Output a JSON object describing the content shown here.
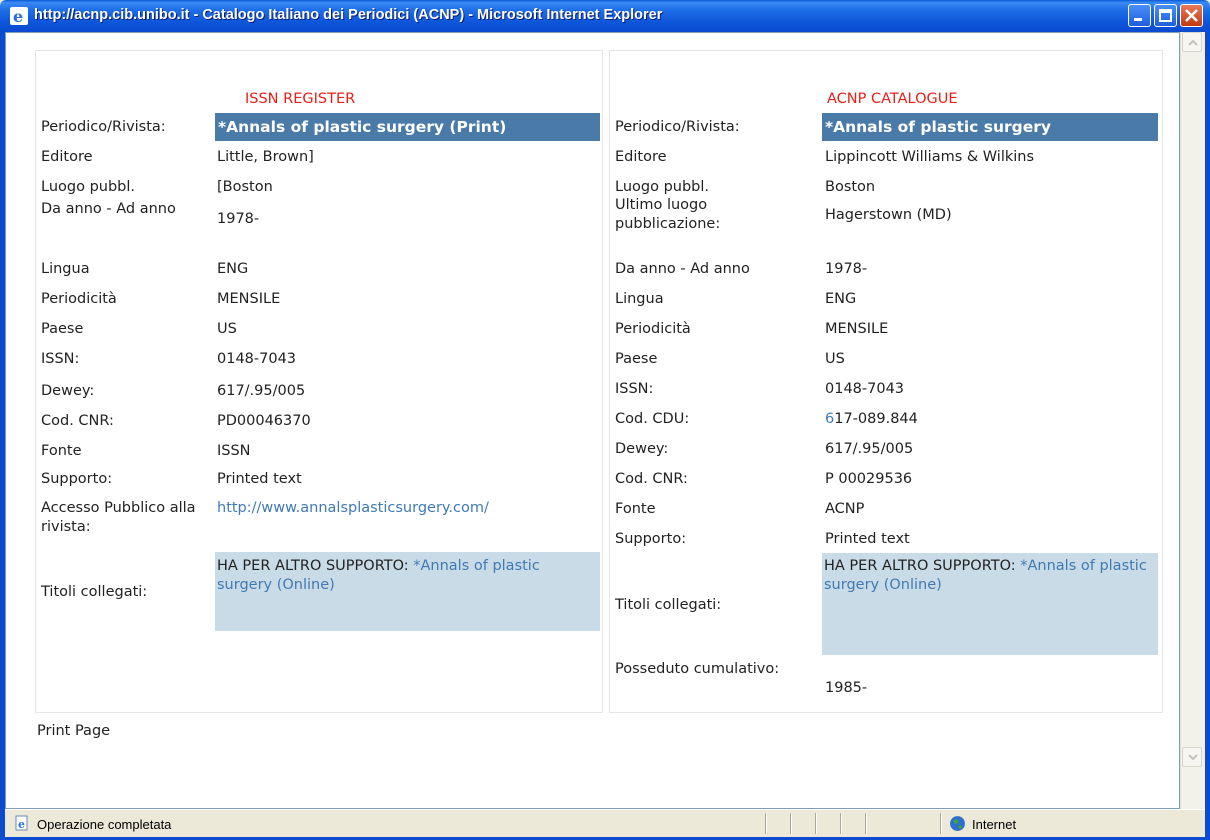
{
  "window": {
    "title": "http://acnp.cib.unibo.it - Catalogo Italiano dei Periodici (ACNP) - Microsoft Internet Explorer"
  },
  "left_panel": {
    "heading": "ISSN REGISTER",
    "title_label": "Periodico/Rivista:",
    "title_value": "*Annals of plastic surgery (Print)",
    "rows": [
      {
        "label": "Editore",
        "value": "Little, Brown]"
      },
      {
        "label": "Luogo pubbl.",
        "value": "[Boston"
      },
      {
        "label": "Da anno - Ad anno",
        "value": "1978-"
      },
      {
        "label": "Lingua",
        "value": "ENG"
      },
      {
        "label": "Periodicità",
        "value": "MENSILE"
      },
      {
        "label": "Paese",
        "value": "US"
      },
      {
        "label": "ISSN:",
        "value": "0148-7043"
      },
      {
        "label": "Dewey:",
        "value": "617/.95/005"
      },
      {
        "label": "Cod. CNR:",
        "value": "PD00046370"
      },
      {
        "label": "Fonte",
        "value": "ISSN"
      },
      {
        "label": "Supporto:",
        "value": "Printed text"
      }
    ],
    "access_label": "Accesso Pubblico alla rivista:",
    "access_link": "http://www.annalsplasticsurgery.com/",
    "linked_label": "Titoli collegati:",
    "linked_prefix": "HA PER ALTRO SUPPORTO:",
    "linked_link": "*Annals of plastic surgery (Online)"
  },
  "right_panel": {
    "heading": "ACNP CATALOGUE",
    "title_label": "Periodico/Rivista:",
    "title_value": "*Annals of plastic surgery",
    "rows": [
      {
        "label": "Editore",
        "value": "Lippincott Williams & Wilkins"
      },
      {
        "label": "Luogo pubbl.",
        "value": "Boston"
      },
      {
        "label": "Ultimo luogo pubblicazione:",
        "value": "Hagerstown (MD)"
      },
      {
        "label": "Da anno - Ad anno",
        "value": "1978-"
      },
      {
        "label": "Lingua",
        "value": "ENG"
      },
      {
        "label": "Periodicità",
        "value": "MENSILE"
      },
      {
        "label": "Paese",
        "value": "US"
      },
      {
        "label": "ISSN:",
        "value": "0148-7043"
      },
      {
        "label": "Cod. CDU:",
        "value_link_char": "6",
        "value": "17-089.844"
      },
      {
        "label": "Dewey:",
        "value": "617/.95/005"
      },
      {
        "label": "Cod. CNR:",
        "value": "P 00029536"
      },
      {
        "label": "Fonte",
        "value": "ACNP"
      },
      {
        "label": "Supporto:",
        "value": "Printed text"
      }
    ],
    "linked_label": "Titoli collegati:",
    "linked_prefix": "HA PER ALTRO SUPPORTO:",
    "linked_link": "*Annals of plastic surgery (Online)",
    "holdings_label": "Posseduto cumulativo:",
    "holdings_value": "1985-"
  },
  "print_label": "Print Page",
  "statusbar": {
    "text": "Operazione completata",
    "zone": "Internet"
  },
  "colors": {
    "heading": "#e8201a",
    "title_highlight": "#4a7aa8",
    "linked_box": "#c9dbe6",
    "link": "#3f7ab5"
  }
}
